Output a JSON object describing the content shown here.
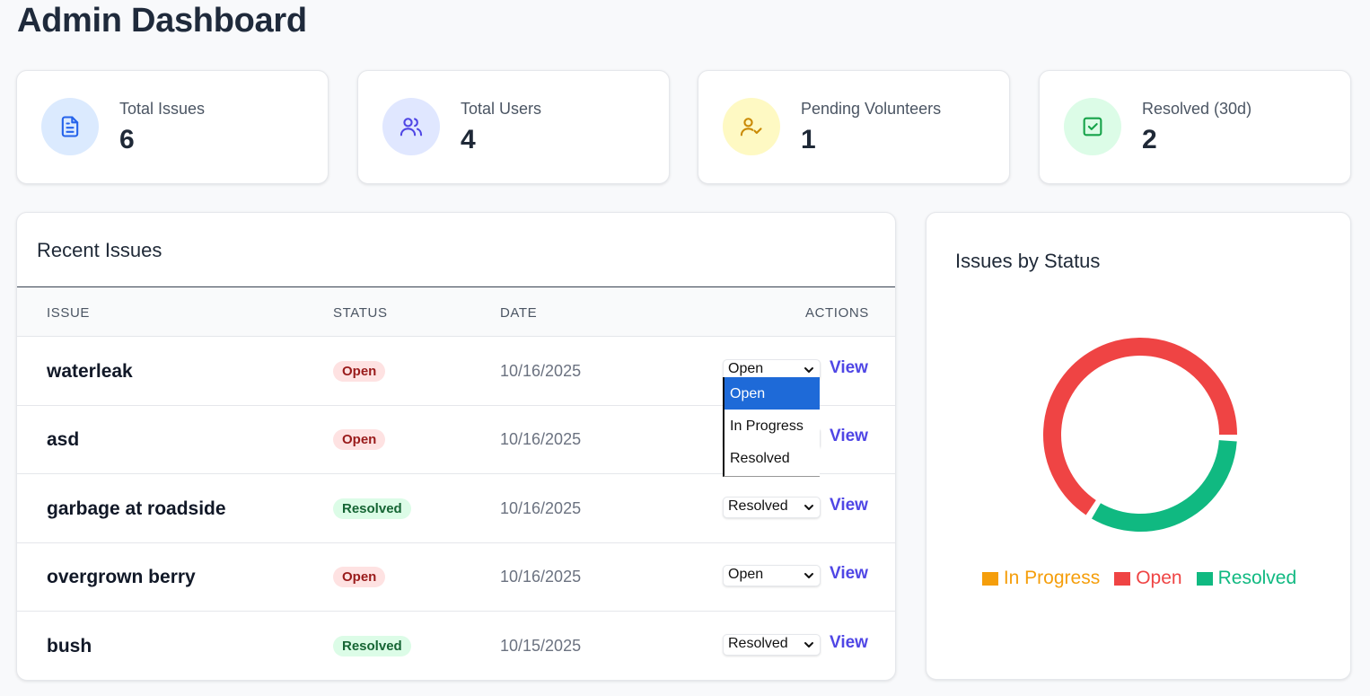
{
  "page": {
    "title": "Admin Dashboard"
  },
  "stats": [
    {
      "label": "Total Issues",
      "value": "6",
      "icon": "document-icon",
      "icon_bg": "#dbeafe",
      "icon_color": "#2563eb"
    },
    {
      "label": "Total Users",
      "value": "4",
      "icon": "users-icon",
      "icon_bg": "#e0e7ff",
      "icon_color": "#4f46e5"
    },
    {
      "label": "Pending Volunteers",
      "value": "1",
      "icon": "user-check-icon",
      "icon_bg": "#fef9c3",
      "icon_color": "#ca8a04"
    },
    {
      "label": "Resolved (30d)",
      "value": "2",
      "icon": "check-square-icon",
      "icon_bg": "#dcfce7",
      "icon_color": "#16a34a"
    }
  ],
  "recent_issues": {
    "title": "Recent Issues",
    "columns": [
      "ISSUE",
      "STATUS",
      "DATE",
      "ACTIONS"
    ],
    "rows": [
      {
        "issue": "waterleak",
        "status": "Open",
        "date": "10/16/2025",
        "select_value": "Open",
        "action": "View"
      },
      {
        "issue": "asd",
        "status": "Open",
        "date": "10/16/2025",
        "select_value": "Open",
        "action": "View"
      },
      {
        "issue": "garbage at roadside",
        "status": "Resolved",
        "date": "10/16/2025",
        "select_value": "Resolved",
        "action": "View"
      },
      {
        "issue": "overgrown berry",
        "status": "Open",
        "date": "10/16/2025",
        "select_value": "Open",
        "action": "View"
      },
      {
        "issue": "bush",
        "status": "Resolved",
        "date": "10/15/2025",
        "select_value": "Resolved",
        "action": "View"
      }
    ],
    "dropdown": {
      "open_row": 0,
      "options": [
        "Open",
        "In Progress",
        "Resolved"
      ],
      "selected": "Open"
    }
  },
  "status_chart": {
    "title": "Issues by Status",
    "colors": {
      "In Progress": "#f59e0b",
      "Open": "#ef4444",
      "Resolved": "#10b981"
    }
  },
  "chart_data": {
    "type": "pie",
    "variant": "doughnut",
    "title": "Issues by Status",
    "categories": [
      "In Progress",
      "Open",
      "Resolved"
    ],
    "values": [
      0,
      4,
      2
    ],
    "legend_position": "bottom"
  }
}
